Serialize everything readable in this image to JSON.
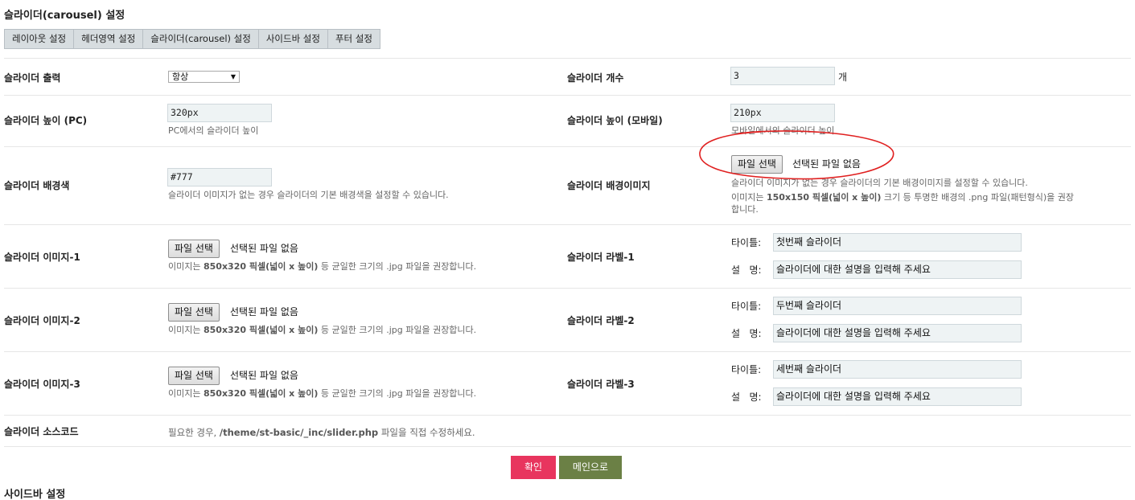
{
  "page_title": "슬라이더(carousel) 설정",
  "tabs": [
    "레이아웃 설정",
    "헤더영역 설정",
    "슬라이더(carousel) 설정",
    "사이드바 설정",
    "푸터 설정"
  ],
  "rows": {
    "output": {
      "label": "슬라이더 출력",
      "select_value": "항상"
    },
    "count": {
      "label": "슬라이더 개수",
      "value": "3",
      "unit": "개"
    },
    "height_pc": {
      "label": "슬라이더 높이 (PC)",
      "value": "320px",
      "help": "PC에서의 슬라이더 높이"
    },
    "height_mobile": {
      "label": "슬라이더 높이 (모바일)",
      "value": "210px",
      "help": "모바일에서의 슬라이더 높이"
    },
    "bg_color": {
      "label": "슬라이더 배경색",
      "value": "#777",
      "help": "슬라이더 이미지가 없는 경우 슬라이더의 기본 배경색을 설정할 수 있습니다."
    },
    "bg_image": {
      "label": "슬라이더 배경이미지",
      "help1": "슬라이더 이미지가 없는 경우 슬라이더의 기본 배경이미지를 설정할 수 있습니다.",
      "help2_pre": "이미지는 ",
      "help2_bold": "150x150 픽셀(넓이 x 높이)",
      "help2_post": " 크기 등 투명한 배경의 .png 파일(패턴형식)을 권장",
      "help3": "합니다."
    },
    "images": [
      {
        "label": "슬라이더 이미지-1"
      },
      {
        "label": "슬라이더 이미지-2"
      },
      {
        "label": "슬라이더 이미지-3"
      }
    ],
    "image_help_pre": "이미지는 ",
    "image_help_bold": "850x320 픽셀(넓이 x 높이)",
    "image_help_post": " 등 균일한 크기의 .jpg 파일을 권장합니다.",
    "labels": [
      {
        "label": "슬라이더 라벨-1",
        "title": "첫번째 슬라이더",
        "desc": "슬라이더에 대한 설명을 입력해 주세요"
      },
      {
        "label": "슬라이더 라벨-2",
        "title": "두번째 슬라이더",
        "desc": "슬라이더에 대한 설명을 입력해 주세요"
      },
      {
        "label": "슬라이더 라벨-3",
        "title": "세번째 슬라이더",
        "desc": "슬라이더에 대한 설명을 입력해 주세요"
      }
    ],
    "title_label": "타이틀:",
    "desc_label": "설   명:",
    "source": {
      "label": "슬라이더 소스코드",
      "help_pre": "필요한 경우, ",
      "help_bold": "/theme/st-basic/_inc/slider.php",
      "help_post": " 파일을 직접 수정하세요."
    }
  },
  "file": {
    "button": "파일 선택",
    "status": "선택된 파일 없음"
  },
  "buttons": {
    "confirm": "확인",
    "main": "메인으로"
  },
  "next_section": "사이드바 설정",
  "colors": {
    "confirm": "#e8355e",
    "main": "#6b8045",
    "annotation": "#e02020"
  }
}
